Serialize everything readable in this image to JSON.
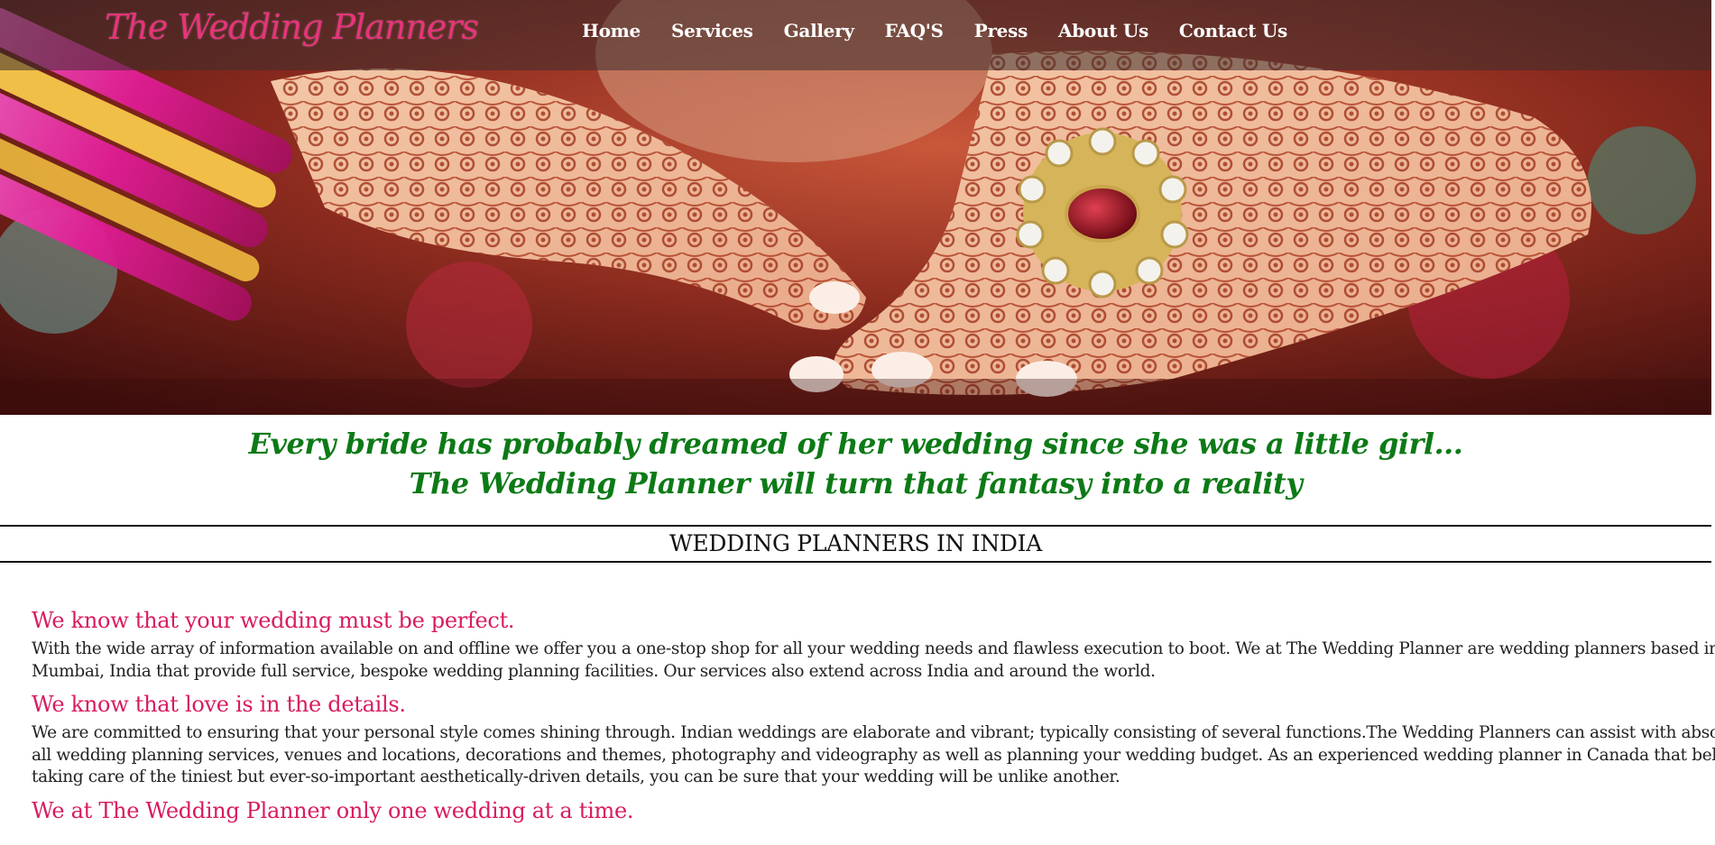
{
  "site": {
    "logo_text": "The Wedding Planners"
  },
  "nav": {
    "items": [
      {
        "label": "Home"
      },
      {
        "label": "Services"
      },
      {
        "label": "Gallery"
      },
      {
        "label": "FAQ'S"
      },
      {
        "label": "Press"
      },
      {
        "label": "About Us"
      },
      {
        "label": "Contact Us"
      }
    ]
  },
  "tagline": {
    "line1": "Every bride has probably dreamed of her wedding since she was a little girl...",
    "line2": "The Wedding Planner will turn that fantasy into a reality"
  },
  "section": {
    "title": "WEDDING PLANNERS IN INDIA"
  },
  "content": {
    "heading1": "We know that your wedding must be perfect.",
    "para1_line1": "With the wide array of information available on and offline we offer you a one-stop shop for all your wedding needs and flawless execution to boot. We at The Wedding Planner are wedding planners based in",
    "para1_line2": "Mumbai, India that provide full service, bespoke wedding planning facilities. Our services also extend across India and around the world.",
    "heading2": "We know that love is in the details.",
    "para2_line1": "We are committed to ensuring that your personal style comes shining through. Indian weddings are elaborate and vibrant; typically consisting of several functions.The Wedding Planners can assist with absolutely",
    "para2_line2": "all wedding planning services, venues and locations, decorations and themes, photography and videography as well as planning your wedding budget. As an experienced wedding planner in Canada that believes in",
    "para2_line3": "taking care of the tiniest but ever-so-important aesthetically-driven details, you can be sure that your wedding will be unlike another.",
    "heading3": "We at The Wedding Planner only one wedding at a time."
  },
  "colors": {
    "logo": "#e8337c",
    "tagline": "#0c7a16",
    "heading": "#d81b60",
    "body_text": "#222222"
  }
}
